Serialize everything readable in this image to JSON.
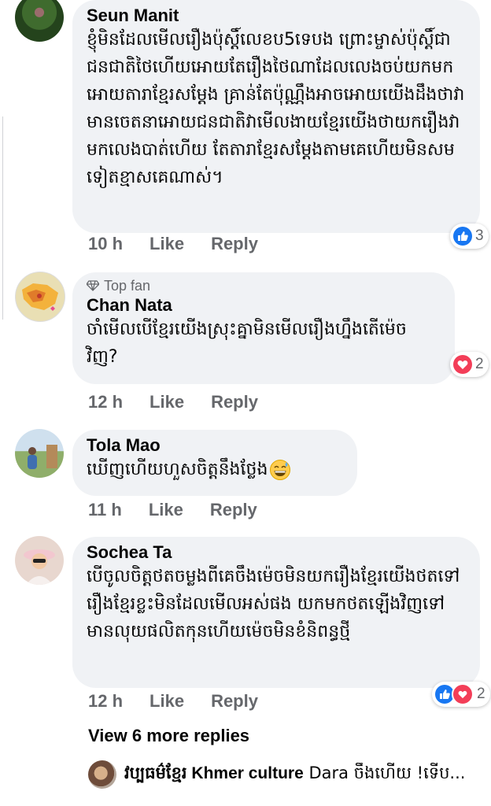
{
  "comments": [
    {
      "name": "Seun Manit",
      "text": "ខ្ញុំមិនដែលមើលរឿងប៉ុស្តិ៍លេខប5ទេបង ព្រោះម្ចាស់ប៉ុស្តិ៍ជាជនជាតិថៃហើយអោយតែរឿងថៃណាដែលលេងចប់យកមកអោយតារាខ្មែរសម្តែង គ្រាន់តែប៉ុណ្ណឹងអាចអោយយើងដឹងថាវាមានចេតនាអោយជនជាតិវាមើលងាយខ្មែរយើងថាយករឿងវាមកលេងបាត់ហើយ តែតារាខ្មែរសម្តែងតាមគេហើយមិនសមទៀតខ្មាសគេណាស់។",
      "time": "10 h",
      "like": "Like",
      "reply": "Reply",
      "reaction_count": "3",
      "reactions": [
        "like-icon"
      ]
    },
    {
      "badge": "Top fan",
      "name": "Chan Nata",
      "text": "ចាំមើលបើខ្មែរយើងស្រុះគ្នាមិនមើលរឿងហ្នឹងតើម៉េចវិញ?",
      "time": "12 h",
      "like": "Like",
      "reply": "Reply",
      "reaction_count": "2",
      "reactions": [
        "love-icon"
      ]
    },
    {
      "name": "Tola Mao",
      "text": "ឃើញហើយហួសចិត្តនឹងថ្លែង",
      "time": "11 h",
      "like": "Like",
      "reply": "Reply"
    },
    {
      "name": "Sochea Ta",
      "text": "បើចូលចិត្តថតចម្លងពីគេចឹងម៉េចមិនយករឿងខ្មែរយើងថតទៅរឿងខ្មែរខ្លះមិនដែលមើលអស់ផង យកមកថតឡើងវិញទៅ មានលុយផលិតកុនហើយម៉េចមិនខំនិពន្ធថ្មី",
      "time": "12 h",
      "like": "Like",
      "reply": "Reply",
      "reaction_count": "2",
      "reactions": [
        "like-icon",
        "love-icon"
      ]
    }
  ],
  "more_replies": "View 6 more replies",
  "last_reply": {
    "name": "វប្បធម៌ខ្មែរ Khmer culture",
    "text": "Dara ចឹងហើយ !ទើប..."
  },
  "colors": {
    "bubble": "#f0f2f5",
    "meta": "#65676b",
    "like": "#1877f2",
    "love": "#f33e58"
  }
}
